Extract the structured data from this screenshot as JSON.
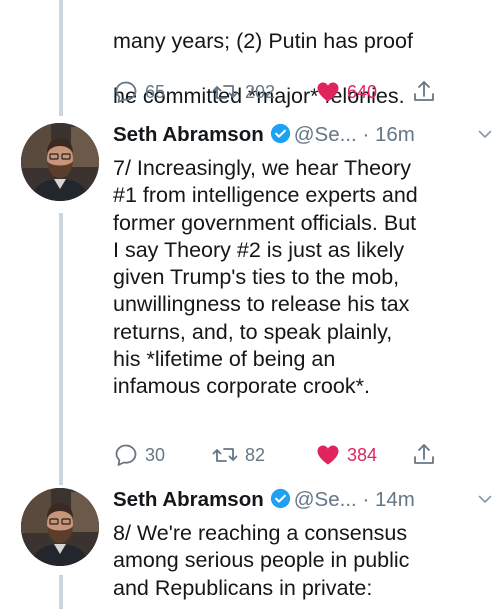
{
  "tweets": [
    {
      "text_lines": [
        "many years; (2) Putin has proof",
        "he committed *major* felonies."
      ],
      "replies": "65",
      "retweets": "202",
      "likes": "640"
    },
    {
      "name": "Seth Abramson",
      "handle": "@Se...",
      "separator": "·",
      "time": "16m",
      "text": "7/ Increasingly, we hear Theory\n#1 from intelligence experts and\nformer government officials. But\nI say Theory #2 is just as likely\ngiven Trump's ties to the mob,\nunwillingness to release his tax\nreturns, and, to speak plainly,\nhis *lifetime of being an\ninfamous corporate crook*.",
      "replies": "30",
      "retweets": "82",
      "likes": "384"
    },
    {
      "name": "Seth Abramson",
      "handle": "@Se...",
      "separator": "·",
      "time": "14m",
      "text": "8/ We're reaching a consensus\namong serious people in public\nand Republicans in private:"
    }
  ],
  "colors": {
    "like": "#e0245e",
    "verified": "#1da1f2",
    "meta": "#657786",
    "thread_line": "#ccd6dd"
  },
  "icons": [
    "reply-icon",
    "retweet-icon",
    "heart-icon",
    "share-icon",
    "verified-badge-icon",
    "chevron-down-icon"
  ]
}
